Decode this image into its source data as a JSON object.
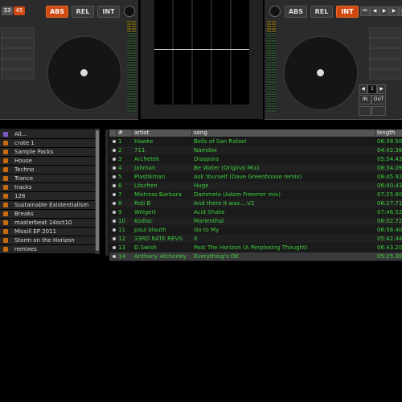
{
  "left_deck": {
    "badge_a": "33",
    "badge_b": "45",
    "modes": [
      "ABS",
      "REL",
      "INT"
    ],
    "active_mode": "ABS"
  },
  "right_deck": {
    "modes": [
      "ABS",
      "REL",
      "INT"
    ],
    "active_mode": "INT",
    "transport_icons": [
      "skip-back-icon",
      "prev-icon",
      "play-icon",
      "next-icon",
      "skip-forward-icon"
    ],
    "loop_value": "1",
    "loop_in": "IN",
    "loop_out": "OUT"
  },
  "sidebar": {
    "items": [
      {
        "label": "All...",
        "icon": "all-icon"
      },
      {
        "label": "crate 1",
        "icon": "crate-icon"
      },
      {
        "label": "Sample Packs",
        "icon": "crate-icon"
      },
      {
        "label": "House",
        "icon": "crate-icon"
      },
      {
        "label": "Techno",
        "icon": "crate-icon"
      },
      {
        "label": "Trance",
        "icon": "crate-icon"
      },
      {
        "label": "tracks",
        "icon": "crate-icon"
      },
      {
        "label": "128",
        "icon": "crate-icon"
      },
      {
        "label": "Sustainable Existentialism",
        "icon": "crate-icon"
      },
      {
        "label": "Breaks",
        "icon": "crate-icon"
      },
      {
        "label": "masterbeat 14oct10",
        "icon": "crate-icon"
      },
      {
        "label": "Missill EP 2011",
        "icon": "crate-icon"
      },
      {
        "label": "Storm on the Horizon",
        "icon": "crate-icon"
      },
      {
        "label": "remixes",
        "icon": "crate-icon"
      }
    ]
  },
  "table": {
    "columns": [
      "#",
      "artist",
      "song",
      "length"
    ],
    "rows": [
      {
        "num": "1",
        "artist": "Hawke",
        "song": "Bells of San Rafael",
        "length": "06:38.50"
      },
      {
        "num": "2",
        "artist": "711",
        "song": "Namdox",
        "length": "04:42.36"
      },
      {
        "num": "3",
        "artist": "Archetek",
        "song": "Diaspora",
        "length": "05:54.43"
      },
      {
        "num": "4",
        "artist": "Jahman",
        "song": "Be Water (Original Mix)",
        "length": "08:34.09"
      },
      {
        "num": "5",
        "artist": "Plastikman",
        "song": "Ask Yourself (Dave Greenhouse remix)",
        "length": "08:45.92"
      },
      {
        "num": "6",
        "artist": "Löschen",
        "song": "Huge",
        "length": "06:40.43"
      },
      {
        "num": "7",
        "artist": "Mistress Barbara",
        "song": "Dammelo (Adam Freemer mix)",
        "length": "07:25.80"
      },
      {
        "num": "8",
        "artist": "Rob B",
        "song": "And there it was....V2",
        "length": "06:27.71"
      },
      {
        "num": "9",
        "artist": "Weigert",
        "song": "Acid Shake",
        "length": "07:46.52"
      },
      {
        "num": "10",
        "artist": "Kodiac",
        "song": "Marienthal",
        "length": "08:02.72"
      },
      {
        "num": "11",
        "artist": "paul blauth",
        "song": "Go to My",
        "length": "06:58.40"
      },
      {
        "num": "12",
        "artist": "33RD RATE REVS",
        "song": "X",
        "length": "05:42.44"
      },
      {
        "num": "13",
        "artist": "D.Swish",
        "song": "Past The Horizon (A Perplexing Thought)",
        "length": "06:43.20"
      },
      {
        "num": "14",
        "artist": "Anthony Atcherley",
        "song": "Everything's OK",
        "length": "05:25.30"
      }
    ],
    "selected_index": 13
  },
  "colors": {
    "accent": "#d04a10",
    "track_text": "#3ecf3e",
    "panel": "#2b2b2b"
  }
}
